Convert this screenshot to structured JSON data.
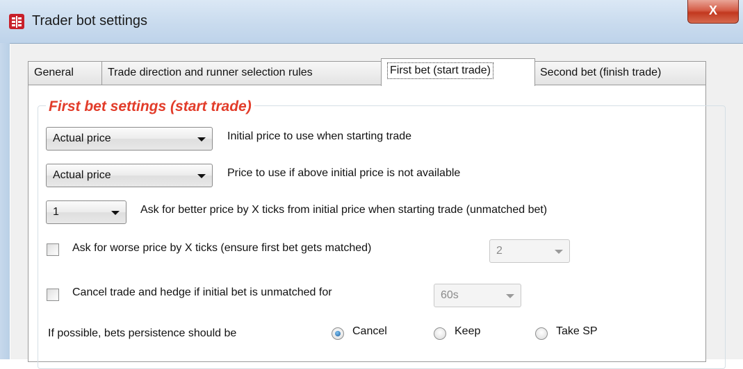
{
  "window": {
    "title": "Trader bot settings",
    "close_label": "X"
  },
  "tabs": [
    {
      "label": "General",
      "active": false
    },
    {
      "label": "Trade direction and runner selection rules",
      "active": false
    },
    {
      "label": "First bet (start trade)",
      "active": true
    },
    {
      "label": "Second bet (finish trade)",
      "active": false
    }
  ],
  "group": {
    "title": "First bet settings (start trade)"
  },
  "settings": {
    "initial_price": {
      "value": "Actual price",
      "label": "Initial price to use when starting trade"
    },
    "fallback_price": {
      "value": "Actual price",
      "label": "Price to use if above initial price is not available"
    },
    "better_price_ticks": {
      "value": "1",
      "label": "Ask for better price by X ticks from initial price when starting trade (unmatched bet)"
    },
    "worse_price": {
      "checked": false,
      "label": "Ask for worse price by X ticks (ensure first bet gets matched)",
      "value": "2",
      "enabled": false
    },
    "cancel_hedge": {
      "checked": false,
      "label": "Cancel trade and hedge if initial bet is unmatched for",
      "value": "60s",
      "enabled": false
    },
    "persistence": {
      "label": "If possible, bets persistence should be",
      "options": [
        "Cancel",
        "Keep",
        "Take SP"
      ],
      "selected": "Cancel"
    }
  },
  "colors": {
    "group_title": "#e23c2a",
    "close_button": "#c2381f",
    "title_bar": "#c9dbee"
  }
}
